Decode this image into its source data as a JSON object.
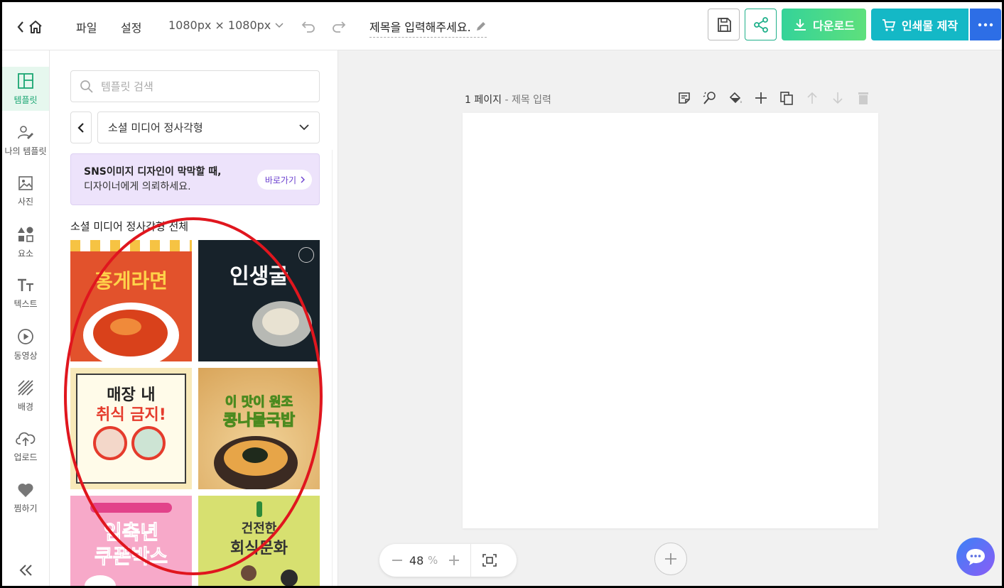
{
  "topbar": {
    "file_label": "파일",
    "settings_label": "설정",
    "size_label": "1080px × 1080px",
    "title": "제목을 입력해주세요.",
    "download_label": "다운로드",
    "print_label": "인쇄물 제작",
    "colors": {
      "download": "#34d399",
      "print": "#14b8c6",
      "more": "#2d6ee6",
      "share": "#1fb08a"
    }
  },
  "rail": {
    "items": [
      {
        "label": "템플릿",
        "icon": "layout-template-icon",
        "active": true
      },
      {
        "label": "나의 템플릿",
        "icon": "user-edit-icon"
      },
      {
        "label": "사진",
        "icon": "image-icon"
      },
      {
        "label": "요소",
        "icon": "shapes-icon"
      },
      {
        "label": "텍스트",
        "icon": "text-icon"
      },
      {
        "label": "동영상",
        "icon": "play-circle-icon"
      },
      {
        "label": "배경",
        "icon": "pattern-icon"
      },
      {
        "label": "업로드",
        "icon": "cloud-upload-icon"
      },
      {
        "label": "찜하기",
        "icon": "heart-icon"
      }
    ]
  },
  "panel": {
    "search_placeholder": "템플릿 검색",
    "category": "소셜 미디어 정사각형",
    "promo": {
      "line1": "SNS이미지 디자인이 막막할 때,",
      "line2": "디자이너에게 의뢰하세요.",
      "button": "바로가기"
    },
    "section_title": "소셜 미디어 정사각형 전체",
    "templates": [
      {
        "headline": "홍게라면",
        "bg": "#e2522c"
      },
      {
        "headline": "인생굴",
        "bg": "#17222a"
      },
      {
        "headline_line1": "매장 내",
        "headline_line2": "취식 금지!",
        "bg": "#f8e9b9"
      },
      {
        "headline_line1": "이 맛이 원조",
        "headline_line2": "콩나물국밥",
        "bg": "#e9c27a"
      },
      {
        "headline_line1": "임축년",
        "headline_line2": "쿠폰박스",
        "bg": "#f7a9c9"
      },
      {
        "headline_line1": "건전한",
        "headline_line2": "회식문화",
        "bg": "#d7e070"
      }
    ]
  },
  "canvas": {
    "page_label": "1 페이지",
    "page_sub": "- 제목 입력",
    "zoom_value": "48",
    "zoom_unit": "%"
  }
}
